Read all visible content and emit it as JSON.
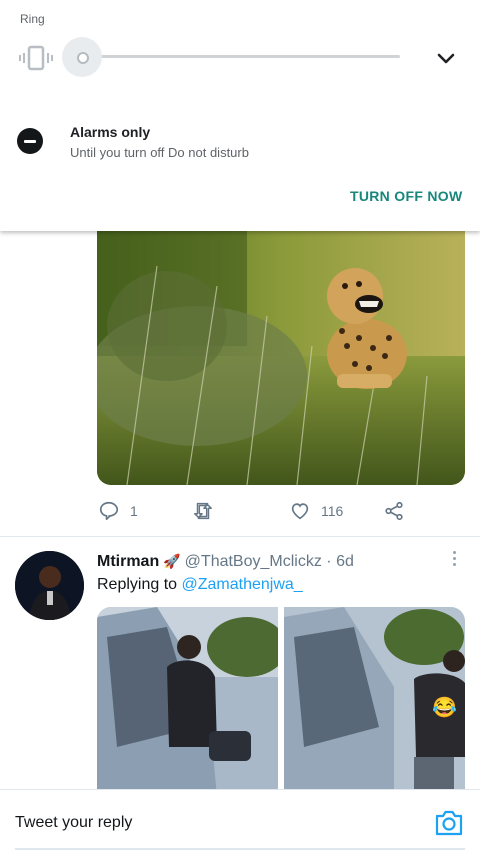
{
  "sound_panel": {
    "stream_label": "Ring",
    "icons": {
      "mode": "vibrate-icon",
      "expand": "chevron-down-icon",
      "dnd": "do-not-disturb-icon"
    },
    "dnd_title": "Alarms only",
    "dnd_subtitle": "Until you turn off Do not disturb",
    "turn_off_label": "TURN OFF NOW",
    "accent_color": "#16877a"
  },
  "tweet_1": {
    "image": "cheetah-in-grass-photo",
    "replies": "1",
    "likes": "116",
    "icons": [
      "reply-icon",
      "retweet-icon",
      "like-icon",
      "share-icon"
    ]
  },
  "tweet_2": {
    "author_name": "Mtirman",
    "author_emoji": "🚀",
    "handle": "@ThatBoy_Mclickz",
    "time": "· 6d",
    "reply_prefix": "Replying to",
    "reply_to": "@Zamathenjwa_",
    "emoji_overlay": "😂",
    "images": [
      "man-by-car-photo-left",
      "man-by-car-photo-right"
    ]
  },
  "reply_bar": {
    "placeholder": "Tweet your reply",
    "icon": "camera-icon",
    "accent_color": "#1da1f2"
  }
}
